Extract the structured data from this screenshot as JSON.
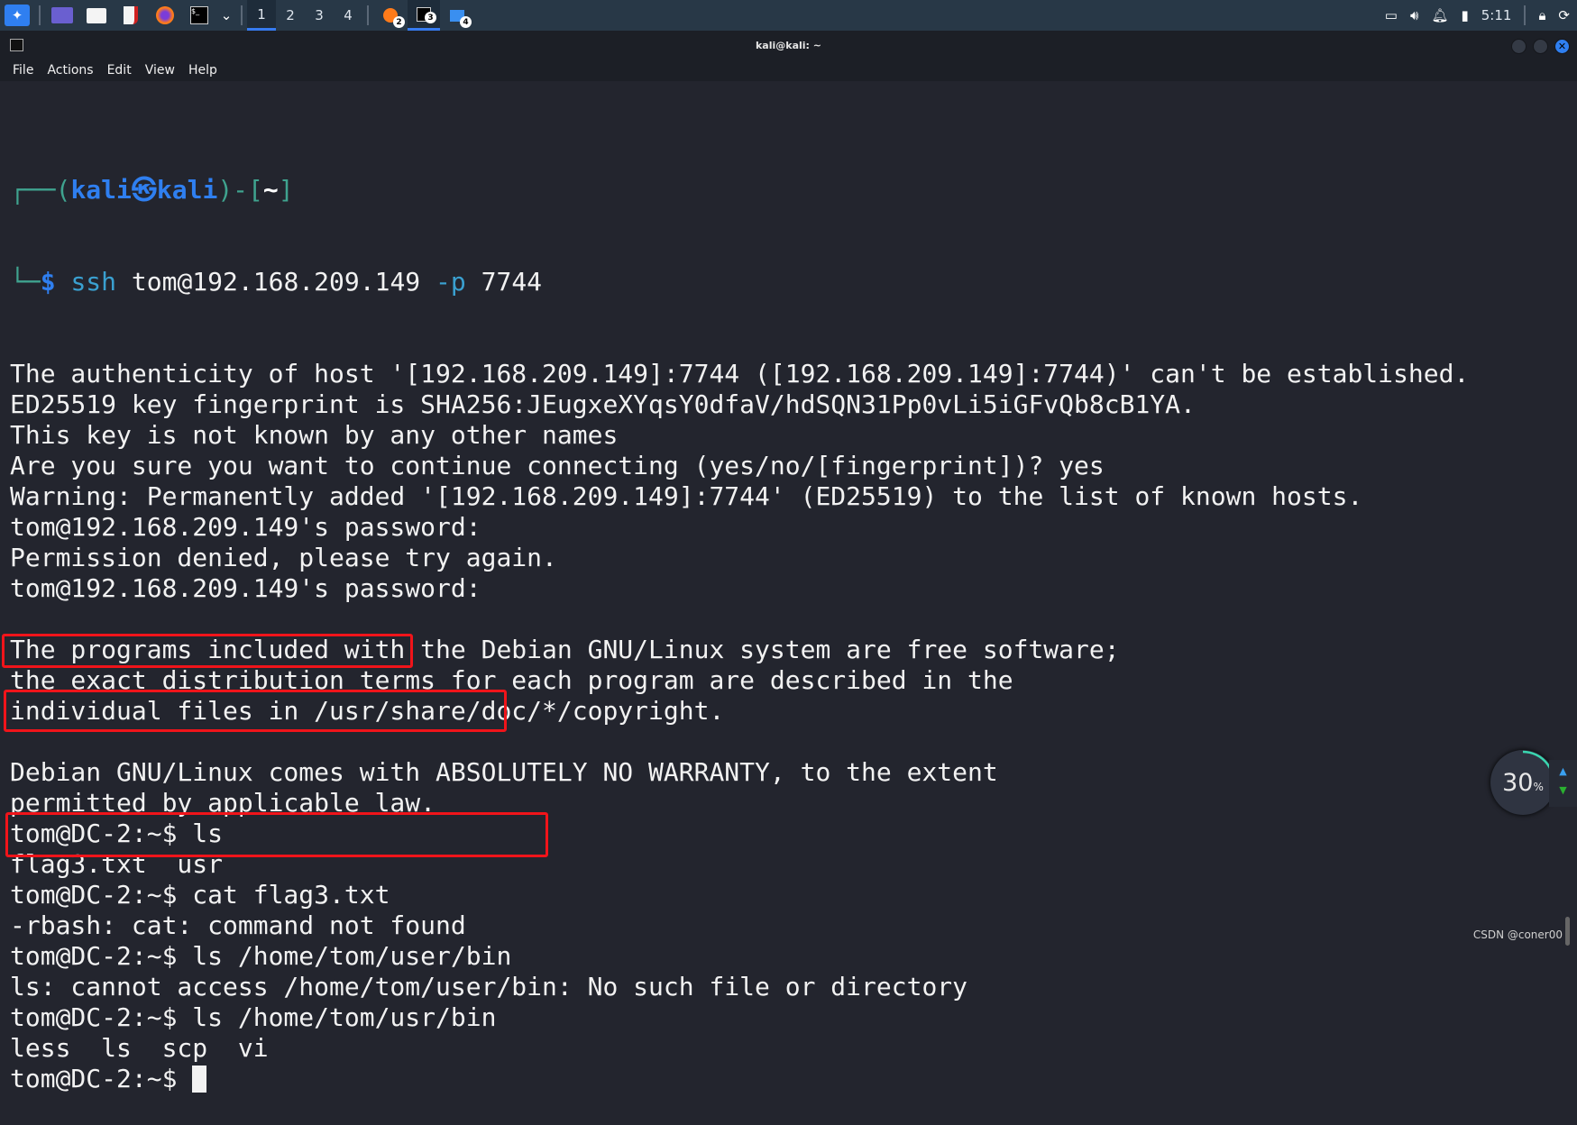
{
  "taskbar": {
    "workspaces": [
      "1",
      "2",
      "3",
      "4"
    ],
    "active_workspace": "1",
    "app_badges": [
      "2",
      "3",
      "4"
    ],
    "clock": "5:11"
  },
  "window": {
    "title": "kali@kali: ~",
    "menu": [
      "File",
      "Actions",
      "Edit",
      "View",
      "Help"
    ]
  },
  "terminal": {
    "prompt_user": "kali",
    "prompt_host": "kali",
    "prompt_dir": "~",
    "ssh_cmd": "ssh",
    "ssh_target": "tom@192.168.209.149",
    "ssh_flag": "-p",
    "ssh_port": "7744",
    "lines": [
      "The authenticity of host '[192.168.209.149]:7744 ([192.168.209.149]:7744)' can't be established.",
      "ED25519 key fingerprint is SHA256:JEugxeXYqsY0dfaV/hdSQN31Pp0vLi5iGFvQb8cB1YA.",
      "This key is not known by any other names",
      "Are you sure you want to continue connecting (yes/no/[fingerprint])? yes",
      "Warning: Permanently added '[192.168.209.149]:7744' (ED25519) to the list of known hosts.",
      "tom@192.168.209.149's password: ",
      "Permission denied, please try again.",
      "tom@192.168.209.149's password: ",
      "",
      "The programs included with the Debian GNU/Linux system are free software;",
      "the exact distribution terms for each program are described in the",
      "individual files in /usr/share/doc/*/copyright.",
      "",
      "Debian GNU/Linux comes with ABSOLUTELY NO WARRANTY, to the extent",
      "permitted by applicable law.",
      "tom@DC-2:~$ ls",
      "flag3.txt  usr",
      "tom@DC-2:~$ cat flag3.txt",
      "-rbash: cat: command not found",
      "tom@DC-2:~$ ls /home/tom/user/bin",
      "ls: cannot access /home/tom/user/bin: No such file or directory",
      "tom@DC-2:~$ ls /home/tom/usr/bin",
      "less  ls  scp  vi",
      "tom@DC-2:~$ "
    ]
  },
  "gauge": {
    "value": "30",
    "unit": "%",
    "percent": 30
  },
  "watermark": "CSDN @coner00",
  "colors": {
    "highlight_box": "#f0141a",
    "accent": "#367bf0",
    "background": "#23252e"
  }
}
